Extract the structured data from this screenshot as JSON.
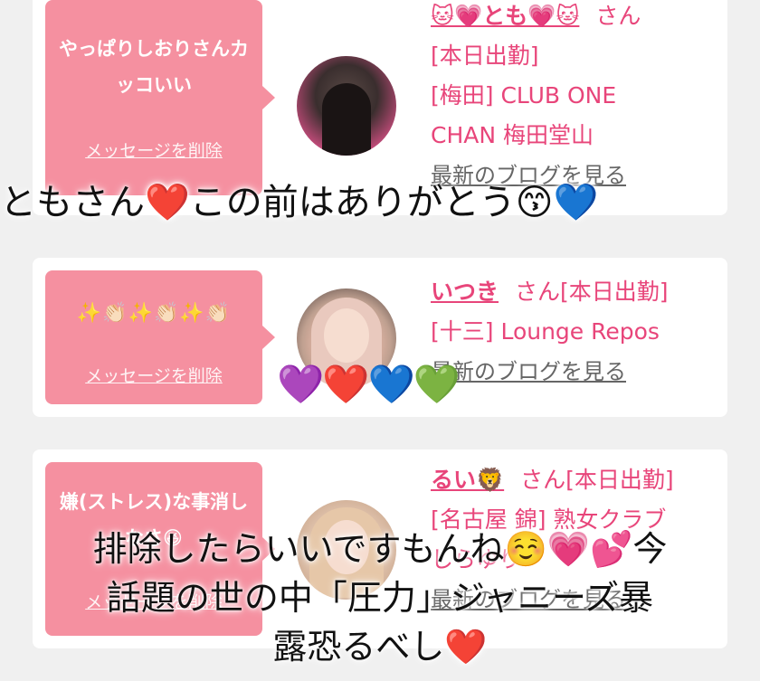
{
  "cards": [
    {
      "bubble_message": "やっぱりしおりさんカッコいい",
      "delete_label": "メッセージを削除",
      "name": "🐱💗とも💗🐱",
      "san": "さん",
      "lines": [
        "[本日出勤]",
        "[梅田] CLUB ONE",
        "CHAN 梅田堂山"
      ],
      "blog": "最新のブログを見る"
    },
    {
      "bubble_message": "✨👏🏻✨👏🏻✨👏🏻",
      "delete_label": "メッセージを削除",
      "name": "いつき",
      "san": "さん[本日出勤]",
      "lines": [
        "[十三] Lounge Repos"
      ],
      "blog": "最新のブログを見る"
    },
    {
      "bubble_message": "嫌(ストレス)な事消しなさ😆",
      "delete_label": "メッセージを削除",
      "name": "るい🦁",
      "san": "さん[本日出勤]",
      "lines": [
        "[名古屋 錦] 熟女クラブ",
        "しらゆり"
      ],
      "blog": "最新のブログを見る"
    }
  ],
  "overlays": {
    "caption_1": "ともさん❤️この前はありがとう😙💙",
    "hearts": "💜❤️💙💚",
    "caption_2_line1": "排除したらいいですもんね☺️💗💕今",
    "caption_2_line2": "話題の世の中「圧力」ジャニーズ暴",
    "caption_2_line3": "露恐るべし❤️"
  },
  "colors": {
    "accent": "#e8457a",
    "bubble": "#f590a0",
    "background": "#f0f0f0"
  }
}
